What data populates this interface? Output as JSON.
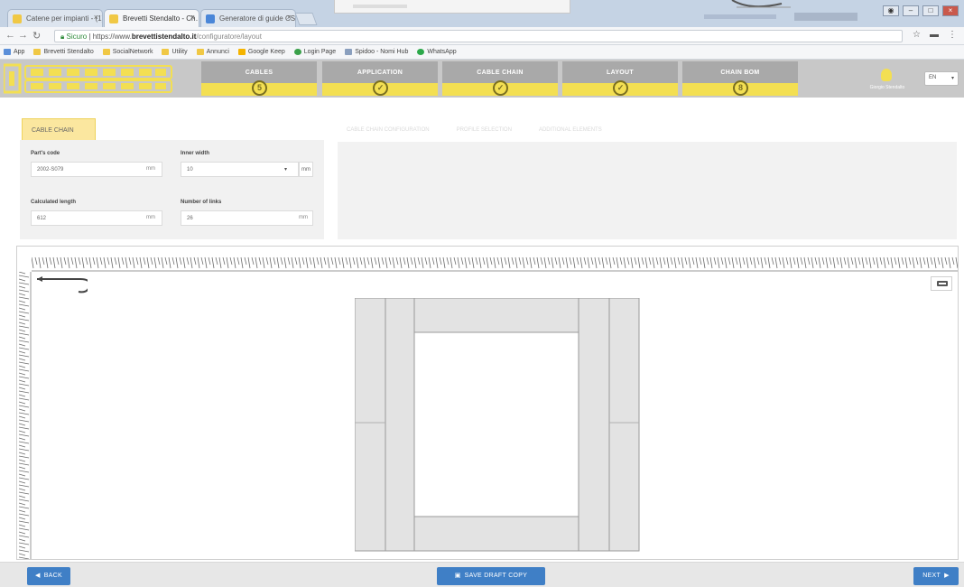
{
  "browser": {
    "tabs": [
      {
        "title": "Catene per impianti - (1) · F1",
        "active": false,
        "favicon_color": "#f0c845"
      },
      {
        "title": "Brevetti Stendalto - Ch…",
        "active": true,
        "favicon_color": "#f0c845"
      },
      {
        "title": "Generatore di guide CS…",
        "active": false,
        "favicon_color": "#4a86d8"
      }
    ],
    "address": {
      "secure_label": "Sicuro",
      "url_prefix": "https://www.",
      "url_host": "brevettistendalto.it",
      "url_path": "/configuratore/layout"
    },
    "bookmarks": [
      "App",
      "Brevetti Stendalto",
      "SocialNetwork",
      "Utility",
      "Annunci",
      "Google Keep",
      "Login Page",
      "Spidoo - Nomi Hub",
      "WhatsApp"
    ]
  },
  "header": {
    "steps": [
      {
        "label": "CABLES",
        "badge": "5"
      },
      {
        "label": "APPLICATION",
        "badge": "✓"
      },
      {
        "label": "CABLE CHAIN",
        "badge": "✓"
      },
      {
        "label": "LAYOUT",
        "badge": "✓"
      },
      {
        "label": "CHAIN BOM",
        "badge": "8"
      }
    ],
    "user_label": "Giorgio Stendalto",
    "language": "EN"
  },
  "config": {
    "active_tab": "CABLE CHAIN",
    "inactive_tabs": [
      "CABLE CHAIN CONFIGURATION",
      "PROFILE SELECTION",
      "ADDITIONAL ELEMENTS"
    ],
    "fields": {
      "part_code": {
        "label": "Part's code",
        "value": "2002-S079",
        "unit": "mm"
      },
      "inner_width": {
        "label": "Inner width",
        "value": "10",
        "unit": "mm"
      },
      "calculated_length": {
        "label": "Calculated length",
        "value": "612",
        "unit": "mm"
      },
      "number_of_links": {
        "label": "Number of links",
        "value": "26",
        "unit": "mm"
      }
    }
  },
  "footer": {
    "back_label": "BACK",
    "save_label": "SAVE DRAFT COPY",
    "next_label": "NEXT"
  }
}
